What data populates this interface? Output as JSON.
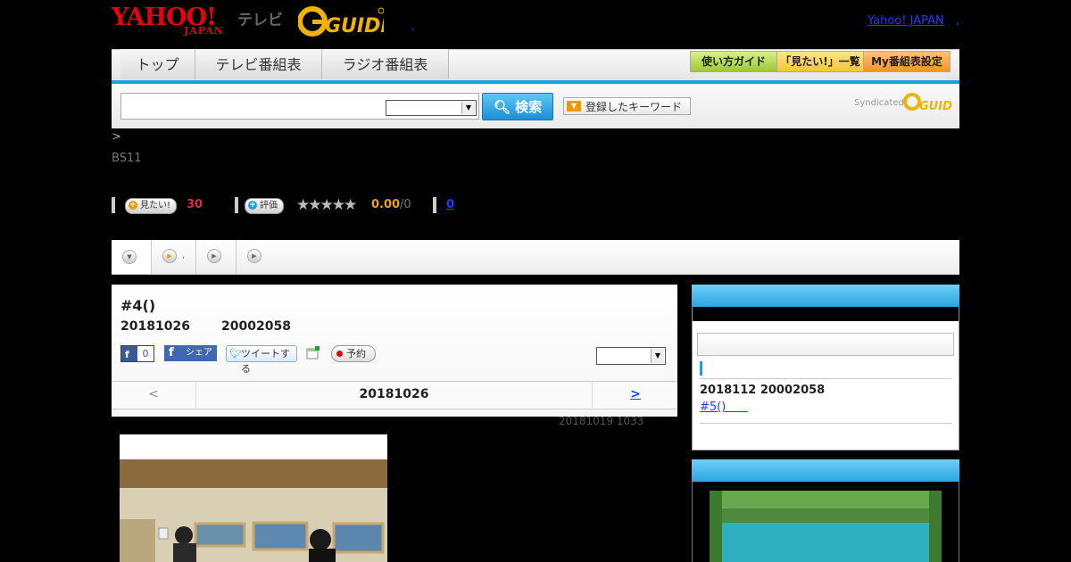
{
  "header": {
    "logo_yahoo": "YAHOO!",
    "logo_japan": "JAPAN",
    "logo_tv": "テレビ",
    "yahoo_link": "Yahoo! JAPAN",
    "link_sep": ",",
    "tiny_dot": ","
  },
  "nav": {
    "tabs": [
      "トップ",
      "テレビ番組表",
      "ラジオ番組表"
    ],
    "guide_buttons": [
      "使い方ガイド",
      "「見たい!」一覧",
      "My番組表設定"
    ]
  },
  "search": {
    "button_label": "検索",
    "keyword_button": "登録したキーワード",
    "syndicated": "Syndicated"
  },
  "program_info": {
    "breadcrumb": ">",
    "station": "BS11",
    "mitai_label": "見たい!",
    "mitai_count": "30",
    "hyouka_label": "評価",
    "stars": "★★★★★",
    "rating": "0.00",
    "rating_total": "/0",
    "comment_count": "0",
    "tab_label_2": ","
  },
  "card": {
    "title": "#4()",
    "date": "20181026",
    "time": "20002058",
    "fb_like_count": "0",
    "fb_share": "シェア",
    "tweet": "ツイートする",
    "reserve": "予約",
    "pager_prev": "<",
    "pager_date": "20181026",
    "pager_next": ">",
    "updated": "20181019  1033"
  },
  "right": {
    "date": "2018112  20002058",
    "link": "#5()      "
  },
  "colors": {
    "accent_blue": "#1aa0dc",
    "yahoo_red": "#e60012",
    "rating_orange": "#e8a020",
    "mitai_red": "#d0304a"
  }
}
